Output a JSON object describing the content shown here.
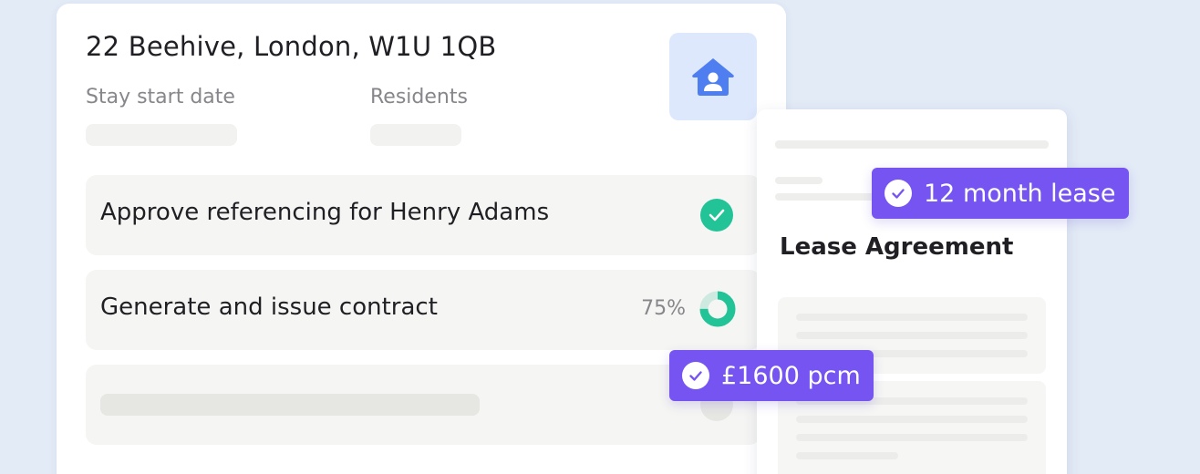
{
  "property": {
    "address": "22 Beehive, London, W1U 1QB",
    "stay_start_label": "Stay start date",
    "residents_label": "Residents",
    "home_icon": "house-person-icon"
  },
  "tasks": [
    {
      "label": "Approve referencing for Henry Adams",
      "status": "complete",
      "icon": "check-circle-icon"
    },
    {
      "label": "Generate and issue contract",
      "progress_text": "75%",
      "progress": 0.75,
      "icon": "progress-donut-icon"
    },
    {
      "label": "",
      "status": "placeholder"
    }
  ],
  "document": {
    "title": "Lease Agreement"
  },
  "badges": {
    "lease_term": "12 month lease",
    "rent": "£1600 pcm"
  },
  "colors": {
    "background": "#e3ebf7",
    "accent_blue": "#4f7ef0",
    "accent_blue_light": "#dde8fd",
    "success_green": "#22c397",
    "badge_purple": "#7554f2"
  }
}
